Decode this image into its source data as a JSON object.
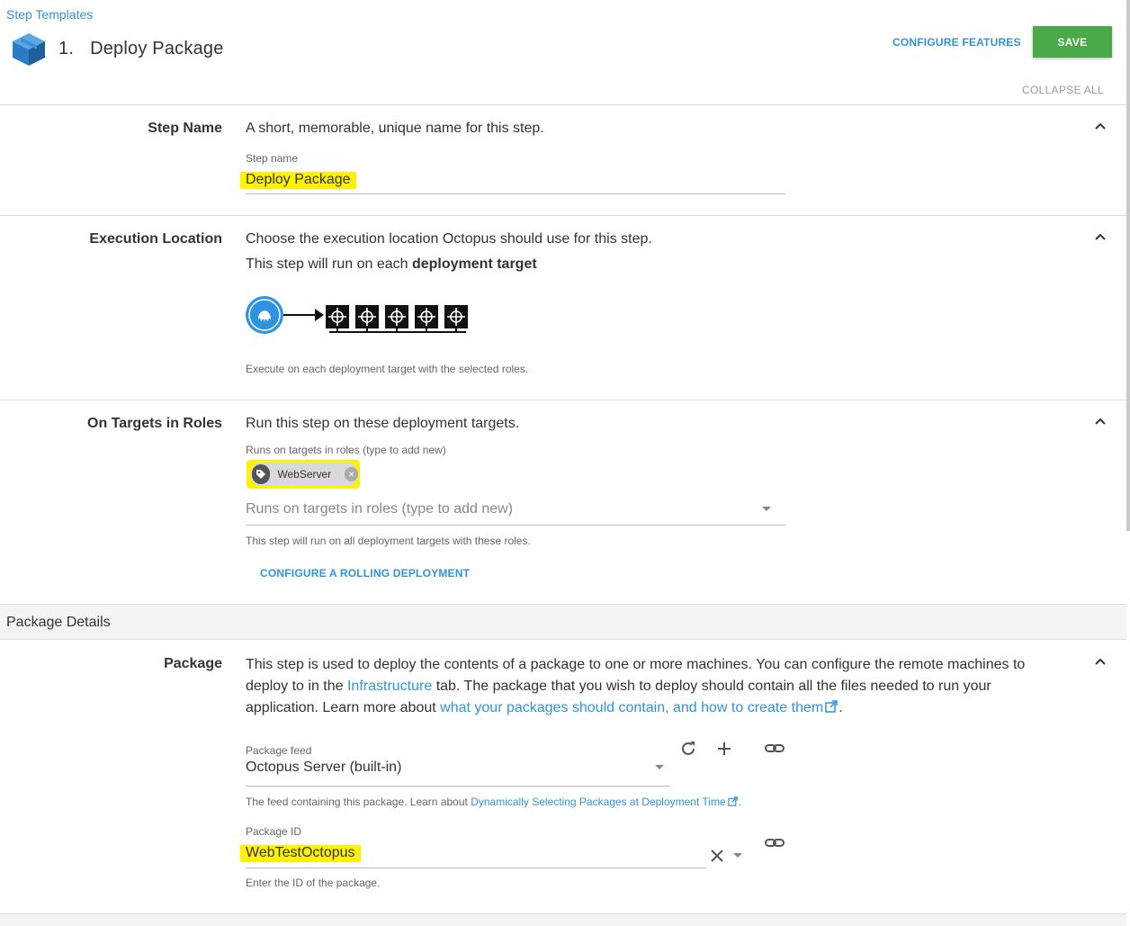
{
  "header": {
    "breadcrumb": "Step Templates",
    "step_number": "1.",
    "title": "Deploy Package",
    "configure_features": "CONFIGURE FEATURES",
    "save": "SAVE",
    "collapse_all": "COLLAPSE ALL"
  },
  "step_name": {
    "label": "Step Name",
    "description": "A short, memorable, unique name for this step.",
    "field_label": "Step name",
    "value": "Deploy Package"
  },
  "execution_location": {
    "label": "Execution Location",
    "description": "Choose the execution location Octopus should use for this step.",
    "run_text_prefix": "This step will run on each",
    "run_text_bold": "deployment target",
    "help": "Execute on each deployment target with the selected roles."
  },
  "targets": {
    "label": "On Targets in Roles",
    "description": "Run this step on these deployment targets.",
    "field_label": "Runs on targets in roles (type to add new)",
    "chip": "WebServer",
    "placeholder": "Runs on targets in roles (type to add new)",
    "help": "This step will run on all deployment targets with these roles.",
    "rolling": "CONFIGURE A ROLLING DEPLOYMENT"
  },
  "package_details": {
    "group_title": "Package Details",
    "label": "Package",
    "desc_1": "This step is used to deploy the contents of a package to one or more machines. You can configure the remote machines to deploy to in the",
    "desc_link_1": "Infrastructure",
    "desc_2": "tab. The package that you wish to deploy should contain all the files needed to run your application. Learn more about",
    "desc_link_2": "what your packages should contain, and how to create them",
    "feed_label": "Package feed",
    "feed_value": "Octopus Server (built-in)",
    "feed_help_prefix": "The feed containing this package. Learn about",
    "feed_help_link": "Dynamically Selecting Packages at Deployment Time",
    "id_label": "Package ID",
    "id_value": "WebTestOctopus",
    "id_help": "Enter the ID of the package."
  },
  "colors": {
    "accent": "#2f93e0",
    "save": "#4aaa4a",
    "highlight": "#fff200"
  }
}
